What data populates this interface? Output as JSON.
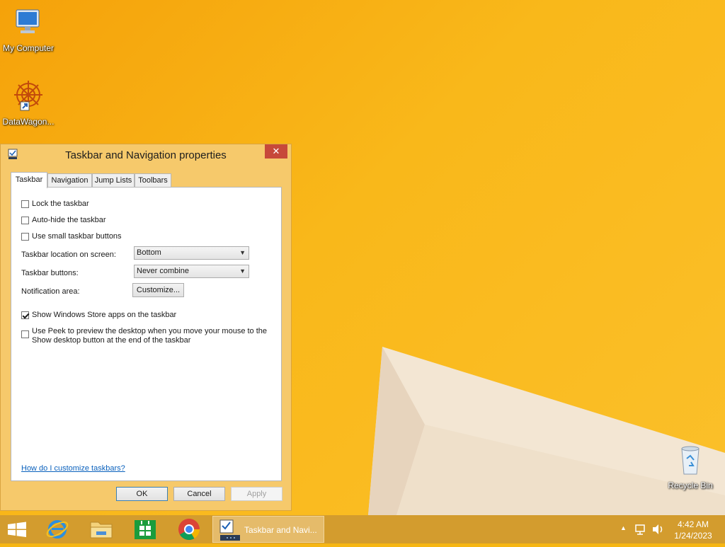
{
  "desktop": {
    "icons": [
      {
        "label": "My Computer"
      },
      {
        "label": "DataWagon..."
      },
      {
        "label": "Recycle Bin"
      }
    ]
  },
  "dialog": {
    "title": "Taskbar and Navigation properties",
    "close_glyph": "✕",
    "tabs": [
      {
        "label": "Taskbar",
        "active": true
      },
      {
        "label": "Navigation"
      },
      {
        "label": "Jump Lists"
      },
      {
        "label": "Toolbars"
      }
    ],
    "options": {
      "lock": {
        "label": "Lock the taskbar",
        "checked": false
      },
      "autohide": {
        "label": "Auto-hide the taskbar",
        "checked": false
      },
      "small": {
        "label": "Use small taskbar buttons",
        "checked": false
      },
      "store": {
        "label": "Show Windows Store apps on the taskbar",
        "checked": true
      },
      "peek": {
        "label_line1": "Use Peek to preview the desktop when you move your mouse to the",
        "label_line2": "Show desktop button at the end of the taskbar",
        "checked": false
      }
    },
    "location": {
      "label": "Taskbar location on screen:",
      "value": "Bottom"
    },
    "buttons_combine": {
      "label": "Taskbar buttons:",
      "value": "Never combine"
    },
    "notification": {
      "label": "Notification area:",
      "button": "Customize..."
    },
    "help_link": "How do I customize taskbars?",
    "ok": "OK",
    "cancel": "Cancel",
    "apply": "Apply"
  },
  "taskbar": {
    "active_window": "Taskbar and Navi...",
    "clock_time": "4:42 AM",
    "clock_date": "1/24/2023",
    "colors": {
      "accent": "#d39c2e",
      "desktop": "#f6b613"
    }
  }
}
